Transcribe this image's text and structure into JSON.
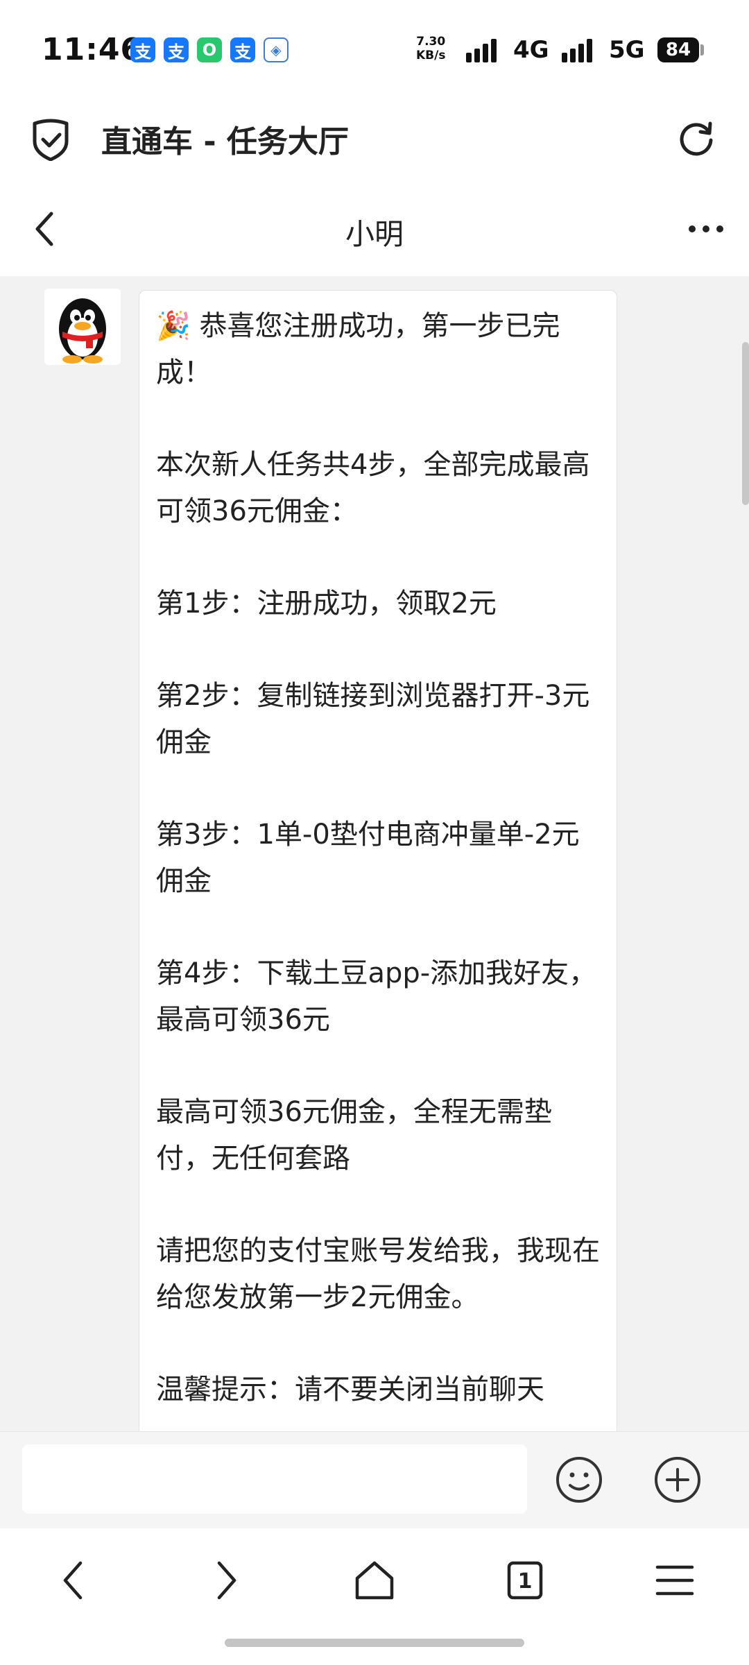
{
  "status_bar": {
    "time": "11:46",
    "notification_icons": [
      "支",
      "支",
      "O",
      "支",
      "◈"
    ],
    "net_speed_value": "7.30",
    "net_speed_unit": "KB/s",
    "network_1": "4G",
    "network_2": "5G",
    "battery": "84"
  },
  "app_bar": {
    "title": "直通车 - 任务大厅"
  },
  "chat": {
    "contact_name": "小明",
    "message_paragraphs": [
      "🎉 恭喜您注册成功，第一步已完成！",
      "本次新人任务共4步，全部完成最高可领36元佣金：",
      "第1步：注册成功，领取2元",
      "第2步：复制链接到浏览器打开-3元佣金",
      "第3步：1单-0垫付电商冲量单-2元佣金",
      "第4步：下载土豆app-添加我好友，最高可领36元",
      "最高可领36元佣金，全程无需垫付，无任何套路",
      "请把您的支付宝账号发给我，我现在给您发放第一步2元佣金。",
      "温馨提示：请不要关闭当前聊天"
    ]
  },
  "input_bar": {
    "placeholder": ""
  },
  "browser_bar": {
    "tab_count": "1"
  }
}
